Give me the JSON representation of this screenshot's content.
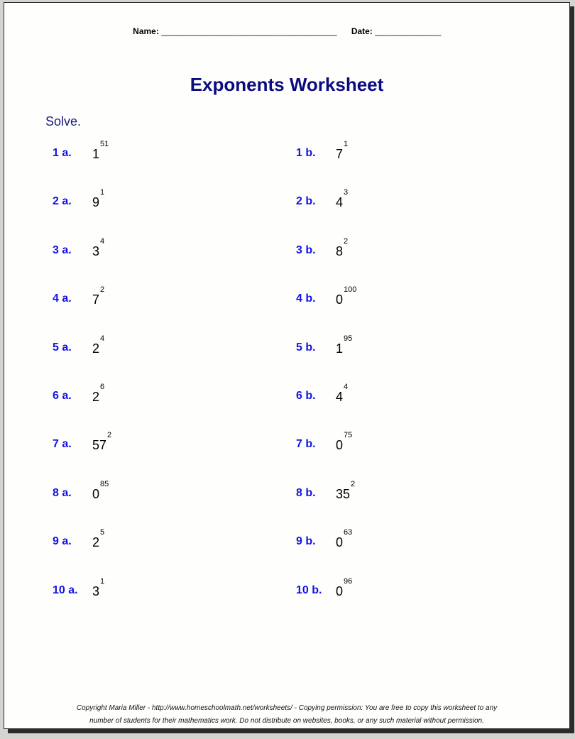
{
  "header": {
    "name_label": "Name:",
    "name_blank": "________________________________________",
    "date_label": "Date:",
    "date_blank": "_______________"
  },
  "title": "Exponents Worksheet",
  "instructions": "Solve.",
  "problems": {
    "left": [
      {
        "label": "1 a.",
        "base": "1",
        "exponent": "51"
      },
      {
        "label": "2 a.",
        "base": "9",
        "exponent": "1"
      },
      {
        "label": "3 a.",
        "base": "3",
        "exponent": "4"
      },
      {
        "label": "4 a.",
        "base": "7",
        "exponent": "2"
      },
      {
        "label": "5 a.",
        "base": "2",
        "exponent": "4"
      },
      {
        "label": "6 a.",
        "base": "2",
        "exponent": "6"
      },
      {
        "label": "7 a.",
        "base": "57",
        "exponent": "2"
      },
      {
        "label": "8 a.",
        "base": "0",
        "exponent": "85"
      },
      {
        "label": "9 a.",
        "base": "2",
        "exponent": "5"
      },
      {
        "label": "10 a.",
        "base": "3",
        "exponent": "1"
      }
    ],
    "right": [
      {
        "label": "1 b.",
        "base": "7",
        "exponent": "1"
      },
      {
        "label": "2 b.",
        "base": "4",
        "exponent": "3"
      },
      {
        "label": "3 b.",
        "base": "8",
        "exponent": "2"
      },
      {
        "label": "4 b.",
        "base": "0",
        "exponent": "100"
      },
      {
        "label": "5 b.",
        "base": "1",
        "exponent": "95"
      },
      {
        "label": "6 b.",
        "base": "4",
        "exponent": "4"
      },
      {
        "label": "7 b.",
        "base": "0",
        "exponent": "75"
      },
      {
        "label": "8 b.",
        "base": "35",
        "exponent": "2"
      },
      {
        "label": "9 b.",
        "base": "0",
        "exponent": "63"
      },
      {
        "label": "10 b.",
        "base": "0",
        "exponent": "96"
      }
    ]
  },
  "footer": {
    "line1": "Copyright Maria Miller - http://www.homeschoolmath.net/worksheets/ - Copying permission: You are free to copy this worksheet to any",
    "line2": "number of students for their mathematics work. Do not distribute on websites, books, or any such material without permission."
  }
}
